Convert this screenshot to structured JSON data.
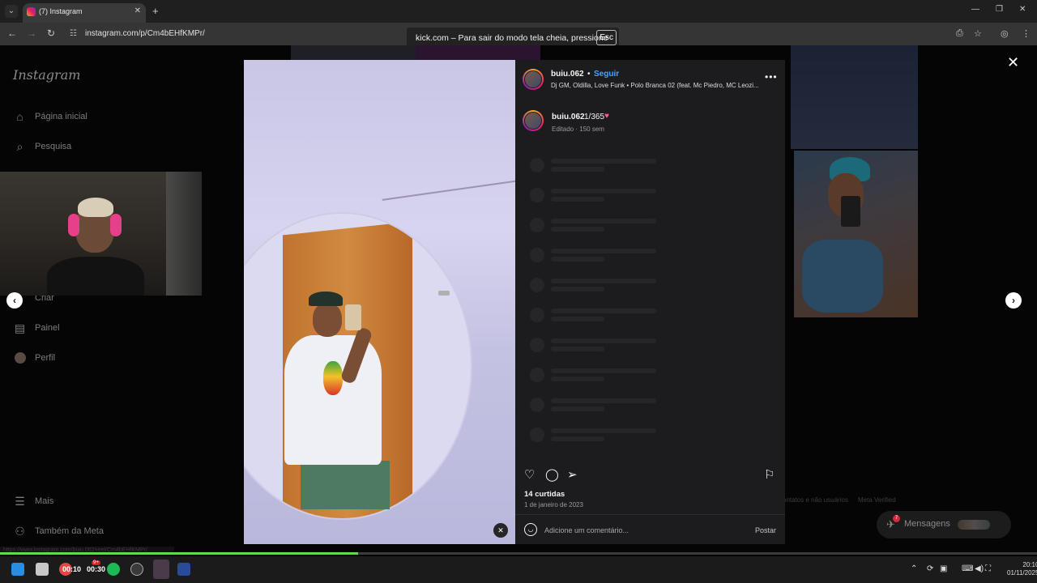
{
  "browser": {
    "tab_title": "(7) Instagram",
    "url": "instagram.com/p/Cm4bEHfKMPr/",
    "fullscreen_notice": "kick.com – Para sair do modo tela cheia, pressione",
    "fullscreen_key": "Esc"
  },
  "sidebar": {
    "logo": "Instagram",
    "items": [
      {
        "label": "Página inicial",
        "icon": "home-icon"
      },
      {
        "label": "Pesquisa",
        "icon": "search-icon"
      },
      {
        "label": "Criar",
        "icon": "plus-icon"
      },
      {
        "label": "Painel",
        "icon": "dashboard-icon"
      },
      {
        "label": "Perfil",
        "icon": "profile-avatar"
      },
      {
        "label": "Mais",
        "icon": "menu-icon"
      },
      {
        "label": "Também da Meta",
        "icon": "meta-icon"
      }
    ]
  },
  "post": {
    "username": "buiu.062",
    "follow_label": "Seguir",
    "audio": "Dj GM, Oldilla, Love Funk • Polo Branca 02 (feat. Mc Piedro, MC Leozi...",
    "caption_user": "buiu.062",
    "caption_text": "1/365",
    "caption_meta": "Editado · 150 sem",
    "likes": "14 curtidas",
    "date": "1 de janeiro de 2023",
    "comment_placeholder": "Adicione um comentário...",
    "post_label": "Postar"
  },
  "footer": {
    "links_fragment": "ontatos e não usuários",
    "meta_verified": "Meta Verified"
  },
  "messages": {
    "label": "Mensagens",
    "badge": "7"
  },
  "status_url": "https://www.instagram.com/buiu.062/reel/Cm4bEHfKMPr/",
  "video": {
    "progress": 0.345
  },
  "taskbar": {
    "timer_left": "00:10",
    "timer_right": "00:30",
    "badge": "9+",
    "clock_time": "20:10",
    "clock_date": "01/11/2025"
  },
  "colors": {
    "follow_blue": "#4aa3ff",
    "progress_green": "#59e049",
    "panel_bg": "#1c1c1e"
  }
}
